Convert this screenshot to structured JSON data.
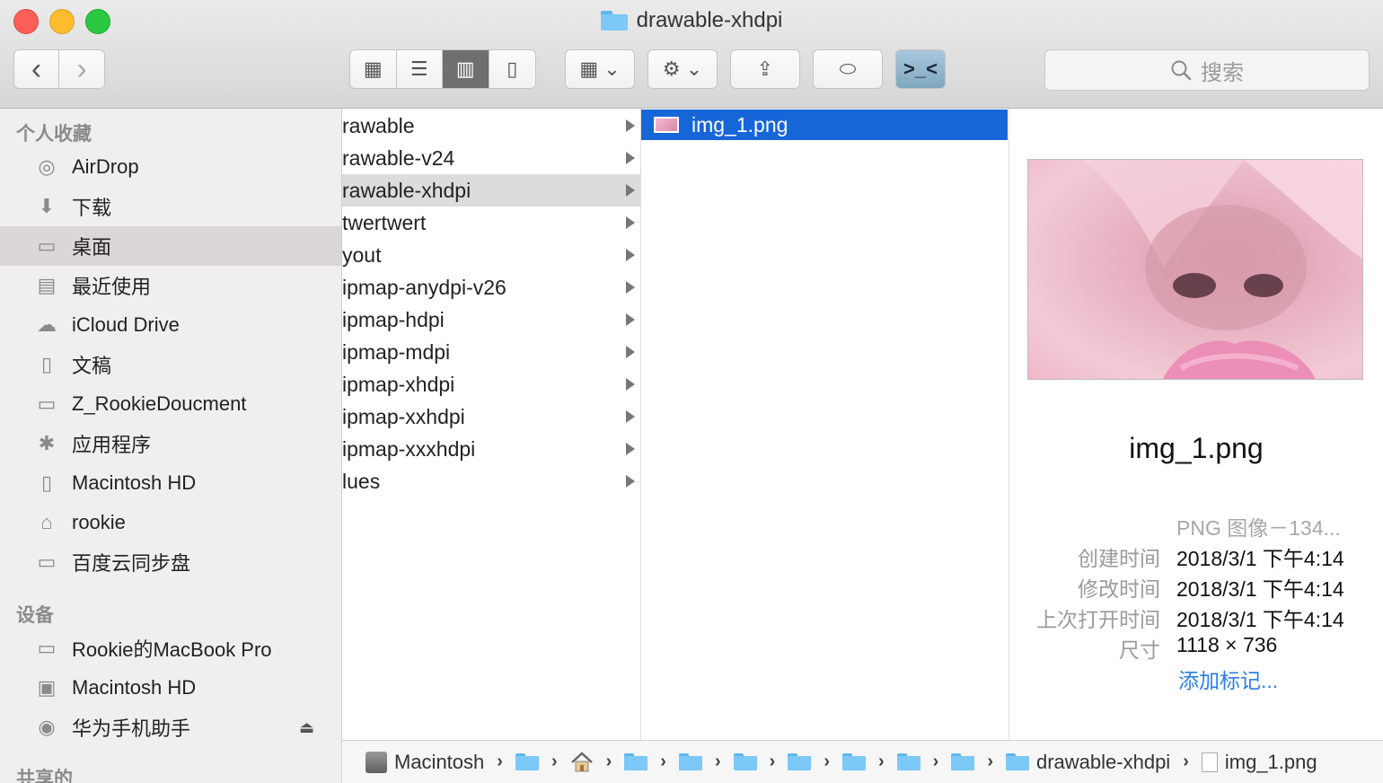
{
  "window": {
    "title": "drawable-xhdpi"
  },
  "toolbar": {
    "back_icon": "‹",
    "forward_icon": "›",
    "view_icons": [
      "▦",
      "☰",
      "▥",
      "▯"
    ],
    "arrange_icon": "▦ ⌄",
    "action_icon": "⚙ ⌄",
    "share_icon": "⇪",
    "tag_icon": "⬭",
    "terminal_icon": ">_<",
    "search_placeholder": "搜索"
  },
  "sidebar": {
    "favorites_header": "个人收藏",
    "favorites": [
      {
        "label": "AirDrop",
        "icon": "◎"
      },
      {
        "label": "下载",
        "icon": "⬇"
      },
      {
        "label": "桌面",
        "icon": "▭"
      },
      {
        "label": "最近使用",
        "icon": "▤"
      },
      {
        "label": "iCloud Drive",
        "icon": "☁"
      },
      {
        "label": "文稿",
        "icon": "▯"
      },
      {
        "label": "Z_RookieDoucment",
        "icon": "▭"
      },
      {
        "label": "应用程序",
        "icon": "✱"
      },
      {
        "label": "Macintosh HD",
        "icon": "▯"
      },
      {
        "label": "rookie",
        "icon": "⌂"
      },
      {
        "label": "百度云同步盘",
        "icon": "▭"
      }
    ],
    "devices_header": "设备",
    "devices": [
      {
        "label": "Rookie的MacBook Pro",
        "icon": "▭"
      },
      {
        "label": "Macintosh HD",
        "icon": "▣"
      },
      {
        "label": "华为手机助手",
        "icon": "◉"
      }
    ],
    "eject_icon": "⏏",
    "shared_header": "共享的"
  },
  "column1": {
    "items": [
      "rawable",
      "rawable-v24",
      "rawable-xhdpi",
      "twertwert",
      "yout",
      "ipmap-anydpi-v26",
      "ipmap-hdpi",
      "ipmap-mdpi",
      "ipmap-xhdpi",
      "ipmap-xxhdpi",
      "ipmap-xxxhdpi",
      "lues"
    ]
  },
  "column2": {
    "file": "img_1.png"
  },
  "preview": {
    "name": "img_1.png",
    "kind": "PNG 图像－134...",
    "created_label": "创建时间",
    "created_value": "2018/3/1 下午4:14",
    "modified_label": "修改时间",
    "modified_value": "2018/3/1 下午4:14",
    "opened_label": "上次打开时间",
    "opened_value": "2018/3/1 下午4:14",
    "size_label": "尺寸",
    "size_value": "1118 × 736",
    "add_tags": "添加标记..."
  },
  "pathbar": {
    "disk": "Macintosh",
    "current_folder": "drawable-xhdpi",
    "file": "img_1.png",
    "sep": "›"
  }
}
